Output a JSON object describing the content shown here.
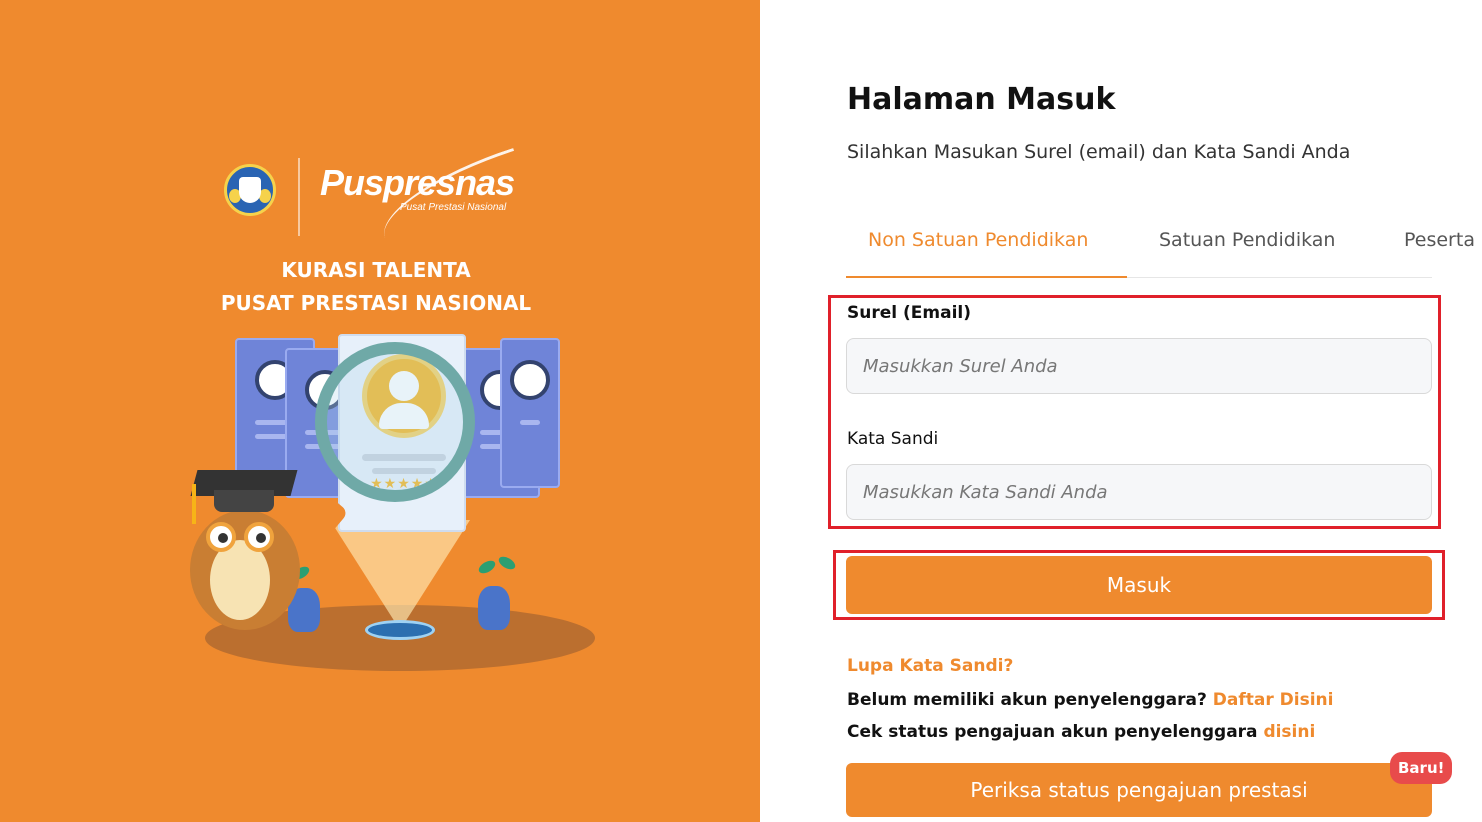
{
  "colors": {
    "brand_orange": "#ef8a2e",
    "highlight_red": "#e0202a",
    "badge_red": "#e84b4b"
  },
  "left_panel": {
    "logo_text": "Puspresnas",
    "logo_subtext": "Pusat Prestasi Nasional",
    "tagline_line1": "KURASI TALENTA",
    "tagline_line2": "PUSAT PRESTASI NASIONAL",
    "illustration_stars": "★★★★★",
    "icons": [
      "government-emblem-icon",
      "puspresnas-logo",
      "owl-mascot-illustration",
      "magnifying-glass-illustration"
    ]
  },
  "login": {
    "title": "Halaman Masuk",
    "subtitle": "Silahkan Masukan Surel (email) dan Kata Sandi Anda",
    "tabs": [
      {
        "label": "Non Satuan Pendidikan",
        "active": true
      },
      {
        "label": "Satuan Pendidikan",
        "active": false
      },
      {
        "label": "Peserta",
        "active": false
      }
    ],
    "email_label": "Surel (Email)",
    "email_placeholder": "Masukkan Surel Anda",
    "email_value": "",
    "password_label": "Kata Sandi",
    "password_placeholder": "Masukkan Kata Sandi Anda",
    "password_value": "",
    "submit_label": "Masuk",
    "forgot_password": "Lupa Kata Sandi?",
    "register_prompt": "Belum memiliki akun penyelenggara?",
    "register_link": "Daftar Disini",
    "status_prompt": "Cek status pengajuan akun penyelenggara",
    "status_link": "disini",
    "check_status_button": "Periksa status pengajuan prestasi",
    "new_badge": "Baru!"
  }
}
